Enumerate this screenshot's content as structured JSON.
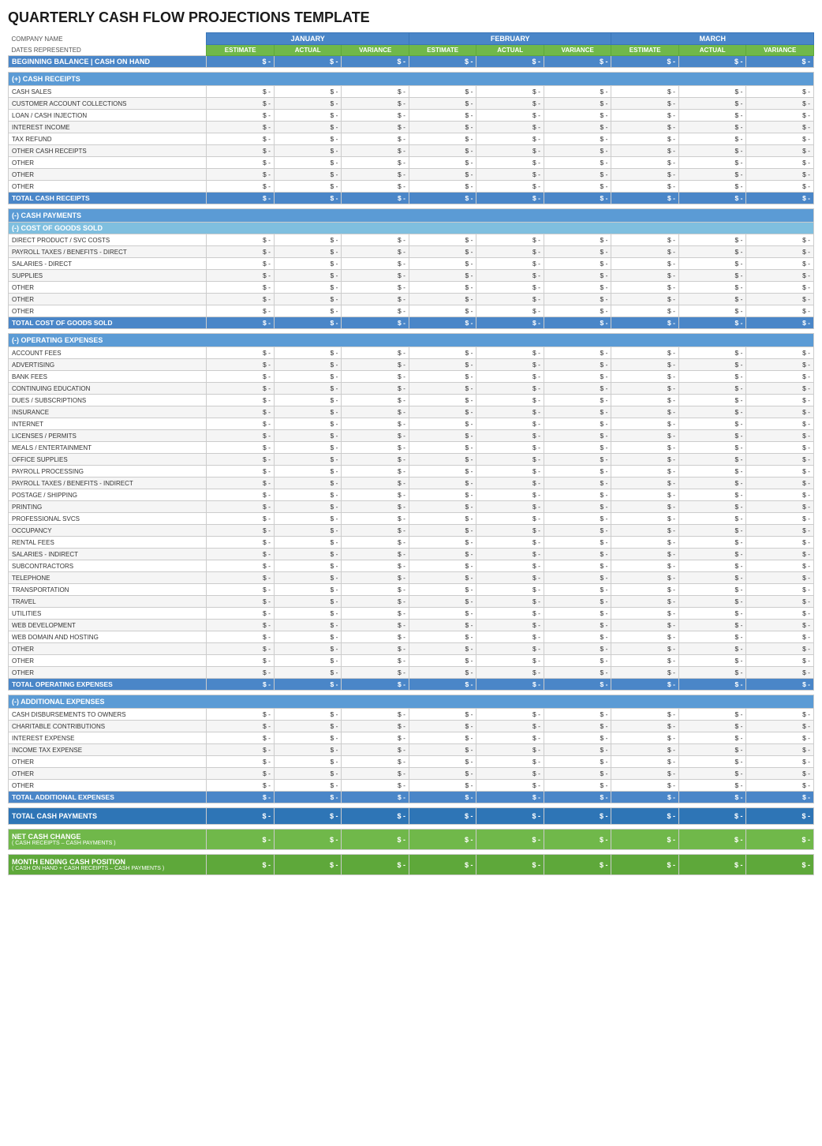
{
  "title": "QUARTERLY CASH FLOW PROJECTIONS TEMPLATE",
  "company_name_label": "COMPANY NAME",
  "dates_label": "DATES REPRESENTED",
  "months": [
    "JANUARY",
    "FEBRUARY",
    "MARCH"
  ],
  "sub_headers": [
    "ESTIMATE",
    "ACTUAL",
    "VARIANCE"
  ],
  "beginning_balance_label": "BEGINNING BALANCE | CASH ON HAND",
  "cash_receipts_section": "(+) CASH RECEIPTS",
  "cash_receipts_items": [
    "CASH SALES",
    "CUSTOMER ACCOUNT COLLECTIONS",
    "LOAN / CASH INJECTION",
    "INTEREST INCOME",
    "TAX REFUND",
    "OTHER CASH RECEIPTS",
    "OTHER",
    "OTHER",
    "OTHER"
  ],
  "total_cash_receipts_label": "TOTAL CASH RECEIPTS",
  "cash_payments_section": "(-) CASH PAYMENTS",
  "cogs_section": "(-) COST OF GOODS SOLD",
  "cogs_items": [
    "DIRECT PRODUCT / SVC COSTS",
    "PAYROLL TAXES / BENEFITS - DIRECT",
    "SALARIES - DIRECT",
    "SUPPLIES",
    "OTHER",
    "OTHER",
    "OTHER"
  ],
  "total_cogs_label": "TOTAL COST OF GOODS SOLD",
  "operating_expenses_section": "(-) OPERATING EXPENSES",
  "operating_items": [
    "ACCOUNT FEES",
    "ADVERTISING",
    "BANK FEES",
    "CONTINUING EDUCATION",
    "DUES / SUBSCRIPTIONS",
    "INSURANCE",
    "INTERNET",
    "LICENSES / PERMITS",
    "MEALS / ENTERTAINMENT",
    "OFFICE SUPPLIES",
    "PAYROLL PROCESSING",
    "PAYROLL TAXES / BENEFITS - INDIRECT",
    "POSTAGE / SHIPPING",
    "PRINTING",
    "PROFESSIONAL SVCS",
    "OCCUPANCY",
    "RENTAL FEES",
    "SALARIES - INDIRECT",
    "SUBCONTRACTORS",
    "TELEPHONE",
    "TRANSPORTATION",
    "TRAVEL",
    "UTILITIES",
    "WEB DEVELOPMENT",
    "WEB DOMAIN AND HOSTING",
    "OTHER",
    "OTHER",
    "OTHER"
  ],
  "total_operating_label": "TOTAL OPERATING EXPENSES",
  "additional_expenses_section": "(-) ADDITIONAL EXPENSES",
  "additional_items": [
    "CASH DISBURSEMENTS TO OWNERS",
    "CHARITABLE CONTRIBUTIONS",
    "INTEREST EXPENSE",
    "INCOME TAX EXPENSE",
    "OTHER",
    "OTHER",
    "OTHER"
  ],
  "total_additional_label": "TOTAL ADDITIONAL EXPENSES",
  "total_cash_payments_label": "TOTAL CASH PAYMENTS",
  "net_cash_change_label": "NET CASH CHANGE",
  "net_cash_change_sub": "( CASH RECEIPTS – CASH PAYMENTS )",
  "month_ending_label": "MONTH ENDING CASH POSITION",
  "month_ending_sub": "( CASH ON HAND + CASH RECEIPTS – CASH PAYMENTS )",
  "dollar_sign": "$",
  "dash": "-"
}
